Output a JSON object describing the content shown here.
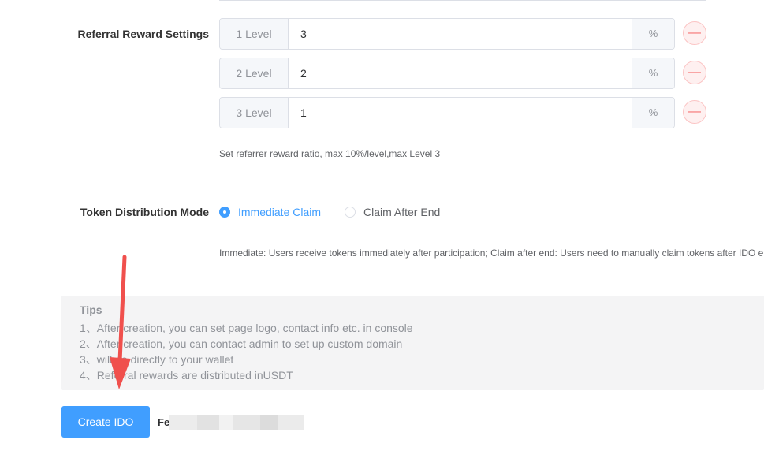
{
  "referral": {
    "label": "Referral Reward Settings",
    "levels": [
      {
        "level_label": "1 Level",
        "value": "3",
        "unit": "%"
      },
      {
        "level_label": "2 Level",
        "value": "2",
        "unit": "%"
      },
      {
        "level_label": "3 Level",
        "value": "1",
        "unit": "%"
      }
    ],
    "remove_icon": "minus-icon",
    "hint": "Set referrer reward ratio, max 10%/level,max Level 3"
  },
  "distribution": {
    "label": "Token Distribution Mode",
    "options": [
      {
        "label": "Immediate Claim",
        "selected": true
      },
      {
        "label": "Claim After End",
        "selected": false
      }
    ],
    "hint": "Immediate: Users receive tokens immediately after participation; Claim after end: Users need to manually claim tokens after IDO e"
  },
  "tips": {
    "title": "Tips",
    "items": [
      "1、After creation, you can set page logo, contact info etc. in console",
      "2、After creation, you can contact admin to set up custom domain",
      "3、will go directly to your wallet",
      "4、Referral rewards are distributed inUSDT"
    ]
  },
  "actions": {
    "create_label": "Create IDO",
    "fee_label": "Fe"
  },
  "colors": {
    "primary": "#409eff",
    "danger": "#f56c6c",
    "annotation_arrow": "#f0504d"
  }
}
